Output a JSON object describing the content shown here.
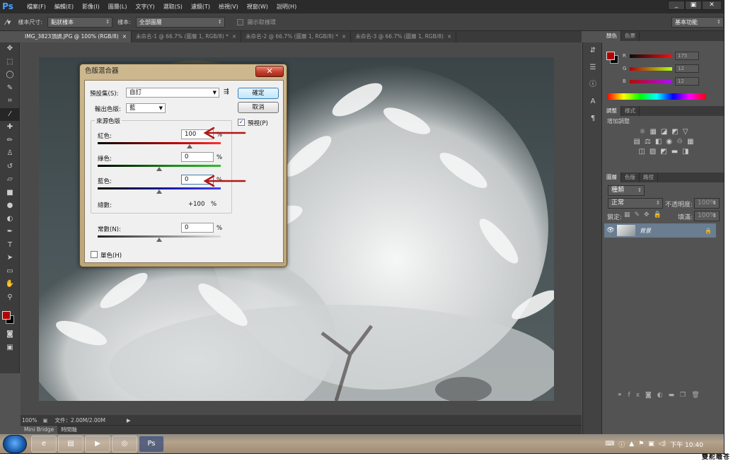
{
  "app": {
    "logo": "Ps"
  },
  "menu": [
    "檔案(F)",
    "編輯(E)",
    "影像(I)",
    "圖層(L)",
    "文字(Y)",
    "選取(S)",
    "濾鏡(T)",
    "檢視(V)",
    "視窗(W)",
    "說明(H)"
  ],
  "window_controls": {
    "minimize": "_",
    "restore": "▣",
    "close": "✕"
  },
  "options_bar": {
    "sample_size_label": "樣本尺寸:",
    "sample_size_value": "點狀樣本",
    "sample_label": "樣本:",
    "sample_value": "全部圖層",
    "show_ring_label": "顯示取樣環",
    "workspace": "基本功能"
  },
  "doc_tabs": [
    {
      "label": "IMG_3823頂調.JPG @ 100% (RGB/8)",
      "close": "×"
    },
    {
      "label": "未命名-1 @ 66.7% (圖層 1, RGB/8) *",
      "close": "×"
    },
    {
      "label": "未命名-2 @ 66.7% (圖層 1, RGB/8) *",
      "close": "×"
    },
    {
      "label": "未命名-3 @ 66.7% (圖層 1, RGB/8)",
      "close": "×"
    }
  ],
  "status": {
    "zoom": "100%",
    "doc_info": "文件：2.00M/2.00M"
  },
  "bottom_tabs": [
    "Mini Bridge",
    "時間軸"
  ],
  "color_panel": {
    "tabs": [
      "顏色",
      "色票"
    ],
    "r": {
      "label": "R",
      "value": "175"
    },
    "g": {
      "label": "G",
      "value": "12"
    },
    "b": {
      "label": "B",
      "value": "12"
    },
    "fg": "#b40000",
    "bg": "#000000"
  },
  "adjust_panel": {
    "tabs": [
      "調整",
      "樣式"
    ],
    "title": "增加調整"
  },
  "layers_panel": {
    "tabs": [
      "圖層",
      "色版",
      "路徑"
    ],
    "filter": "種類",
    "blend": "正常",
    "opacity_label": "不透明度:",
    "opacity": "100%",
    "lock_label": "鎖定:",
    "fill_label": "填滿:",
    "fill": "100%",
    "layer_name": "背景"
  },
  "dialog": {
    "title": "色版混合器",
    "close": "✕",
    "preset_label": "預設集(S):",
    "preset_value": "自訂",
    "output_label": "輸出色版:",
    "output_value": "藍",
    "ok": "確定",
    "cancel": "取消",
    "preview_label": "預視(P)",
    "preview_check": "✓",
    "source_group": "來源色版",
    "red_label": "紅色:",
    "red_value": "100",
    "green_label": "綠色:",
    "green_value": "0",
    "blue_label": "藍色:",
    "blue_value": "0",
    "pct": "%",
    "total_label": "總數:",
    "total_value": "+100",
    "constant_label": "常數(N):",
    "constant_value": "0",
    "mono_label": "單色(H)"
  },
  "tray": {
    "time": "下午 10:40"
  },
  "credit": "雙舵瞻苍"
}
